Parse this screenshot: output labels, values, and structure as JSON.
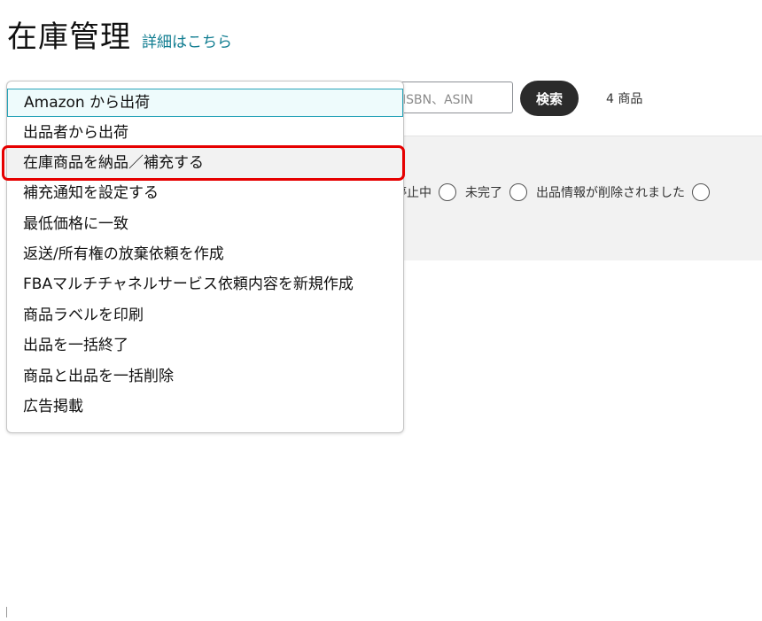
{
  "header": {
    "title": "在庫管理",
    "detail_link": "詳細はこちら"
  },
  "search": {
    "placeholder": "ISBN、ASIN",
    "button_label": "検索",
    "item_count": "4 商品"
  },
  "filters": {
    "options": [
      "停止中",
      "未完了",
      "出品情報が削除されました"
    ]
  },
  "dropdown": {
    "items": [
      "Amazon から出荷",
      "出品者から出荷",
      "在庫商品を納品／補充する",
      "補充通知を設定する",
      "最低価格に一致",
      "返送/所有権の放棄依頼を作成",
      "FBAマルチチャネルサービス依頼内容を新規作成",
      "商品ラベルを印刷",
      "出品を一括終了",
      "商品と出品を一括削除",
      "広告掲載"
    ],
    "selected_index": 0,
    "highlighted_index": 2
  },
  "colors": {
    "accent": "#0f7c90",
    "highlight": "#e60000",
    "selected_border": "#27a3b8"
  }
}
